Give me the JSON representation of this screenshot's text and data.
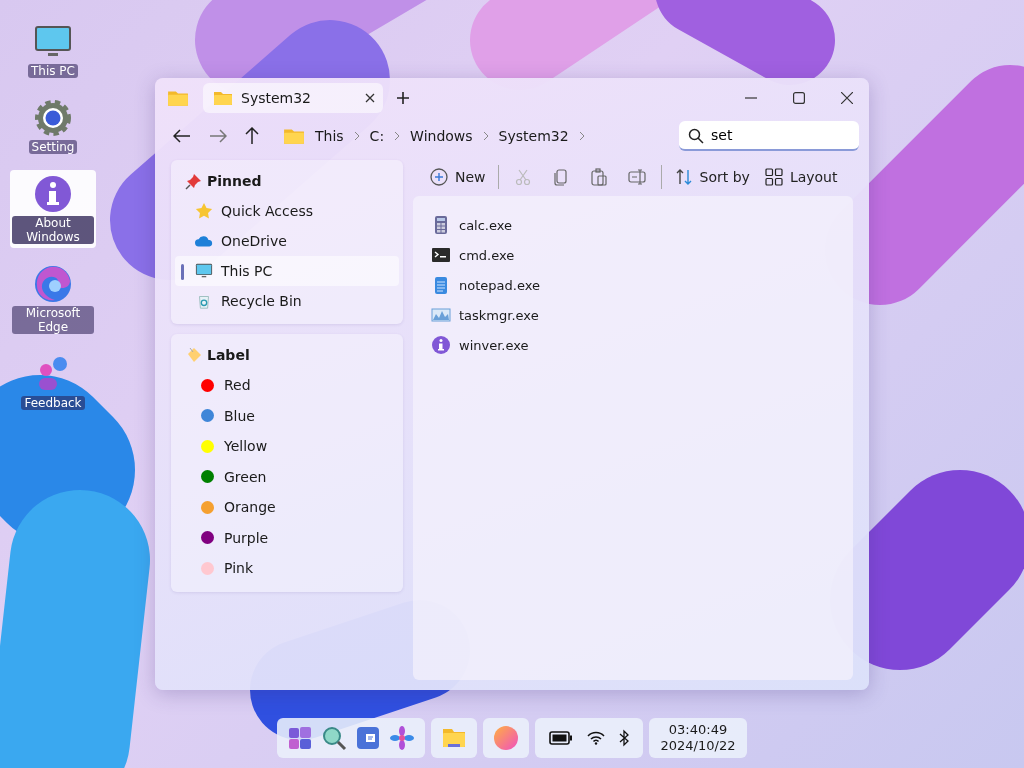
{
  "desktop_icons": [
    {
      "label": "This PC",
      "kind": "monitor",
      "selected": false
    },
    {
      "label": "Setting",
      "kind": "gear",
      "selected": false
    },
    {
      "label": "About Windows",
      "kind": "info",
      "selected": true
    },
    {
      "label": "Microsoft Edge",
      "kind": "edge",
      "selected": false
    },
    {
      "label": "Feedback",
      "kind": "feedback",
      "selected": false
    }
  ],
  "window": {
    "tabs": [
      {
        "label": "System32",
        "selected": true
      }
    ],
    "breadcrumb": [
      "This",
      "C:",
      "Windows",
      "System32"
    ],
    "search": {
      "value": "set"
    },
    "toolbar": [
      {
        "kind": "new",
        "label": "New",
        "disabled": false
      },
      {
        "kind": "cut",
        "disabled": true
      },
      {
        "kind": "copy",
        "disabled": false
      },
      {
        "kind": "paste",
        "disabled": false
      },
      {
        "kind": "rename",
        "disabled": false
      },
      {
        "kind": "sort",
        "label": "Sort by",
        "disabled": false
      },
      {
        "kind": "layout",
        "label": "Layout",
        "disabled": false
      }
    ],
    "sidebar": {
      "pinned": {
        "title": "Pinned",
        "items": [
          {
            "label": "Quick Access",
            "kind": "star",
            "selected": false
          },
          {
            "label": "OneDrive",
            "kind": "cloud",
            "selected": false
          },
          {
            "label": "This PC",
            "kind": "monitor",
            "selected": true
          },
          {
            "label": "Recycle Bin",
            "kind": "bin",
            "selected": false
          }
        ]
      },
      "labels": {
        "title": "Label",
        "items": [
          {
            "label": "Red",
            "color": "#ff0000"
          },
          {
            "label": "Blue",
            "color": "#3f86d8"
          },
          {
            "label": "Yellow",
            "color": "#ffff00"
          },
          {
            "label": "Green",
            "color": "#008000"
          },
          {
            "label": "Orange",
            "color": "#f5a030"
          },
          {
            "label": "Purple",
            "color": "#800080"
          },
          {
            "label": "Pink",
            "color": "#ffc8d0"
          }
        ]
      }
    },
    "files": [
      {
        "name": "calc.exe",
        "kind": "calculator"
      },
      {
        "name": "cmd.exe",
        "kind": "terminal"
      },
      {
        "name": "notepad.exe",
        "kind": "notepad"
      },
      {
        "name": "taskmgr.exe",
        "kind": "chart"
      },
      {
        "name": "winver.exe",
        "kind": "info"
      }
    ]
  },
  "taskbar": {
    "groups": [
      [
        {
          "kind": "start"
        },
        {
          "kind": "search"
        },
        {
          "kind": "widgets"
        },
        {
          "kind": "pinwheel"
        }
      ],
      [
        {
          "kind": "explorer"
        }
      ],
      [
        {
          "kind": "orb"
        }
      ]
    ],
    "clock": {
      "time": "03:40:49",
      "date": "2024/10/22"
    }
  }
}
